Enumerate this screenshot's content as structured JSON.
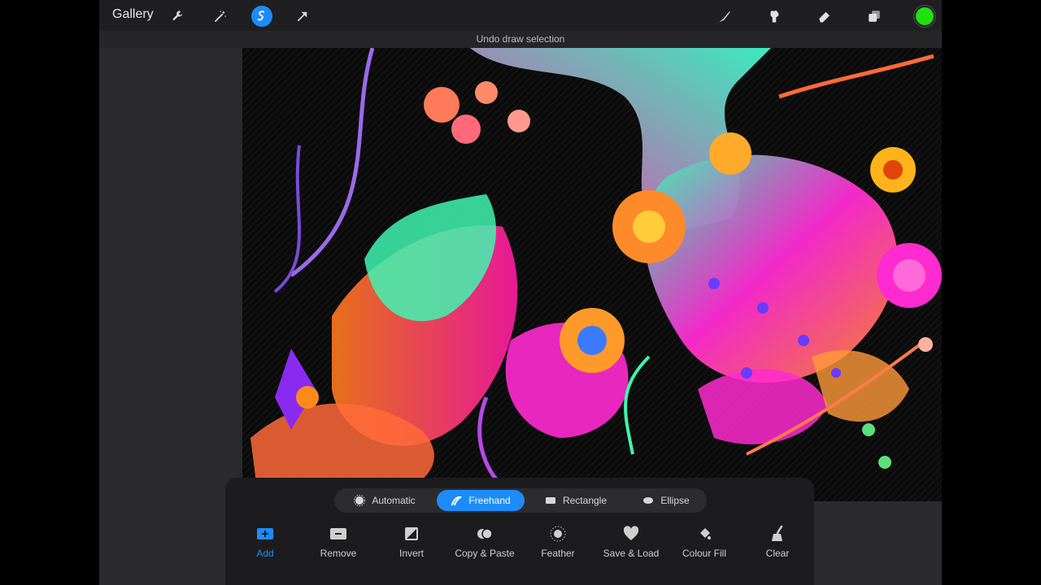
{
  "toolbar": {
    "gallery_label": "Gallery",
    "left_tools": [
      {
        "name": "actions-wrench-icon"
      },
      {
        "name": "adjustments-wand-icon"
      },
      {
        "name": "selection-icon"
      },
      {
        "name": "transform-arrow-icon"
      }
    ],
    "right_tools": [
      {
        "name": "brush-icon"
      },
      {
        "name": "smudge-icon"
      },
      {
        "name": "eraser-icon"
      },
      {
        "name": "layers-icon"
      },
      {
        "name": "color-swatch"
      }
    ],
    "current_color": "#22e010",
    "accent": "#1d8cf8"
  },
  "status": {
    "text": "Undo draw selection"
  },
  "selection_panel": {
    "modes": [
      {
        "label": "Automatic",
        "icon": "automatic-icon"
      },
      {
        "label": "Freehand",
        "icon": "freehand-icon",
        "active": true
      },
      {
        "label": "Rectangle",
        "icon": "rectangle-icon"
      },
      {
        "label": "Ellipse",
        "icon": "ellipse-icon"
      }
    ],
    "actions": [
      {
        "label": "Add",
        "icon": "add-icon",
        "active": true
      },
      {
        "label": "Remove",
        "icon": "remove-icon"
      },
      {
        "label": "Invert",
        "icon": "invert-icon"
      },
      {
        "label": "Copy & Paste",
        "icon": "copy-paste-icon"
      },
      {
        "label": "Feather",
        "icon": "feather-icon"
      },
      {
        "label": "Save & Load",
        "icon": "heart-icon"
      },
      {
        "label": "Colour Fill",
        "icon": "colour-fill-icon"
      },
      {
        "label": "Clear",
        "icon": "clear-icon"
      }
    ]
  }
}
